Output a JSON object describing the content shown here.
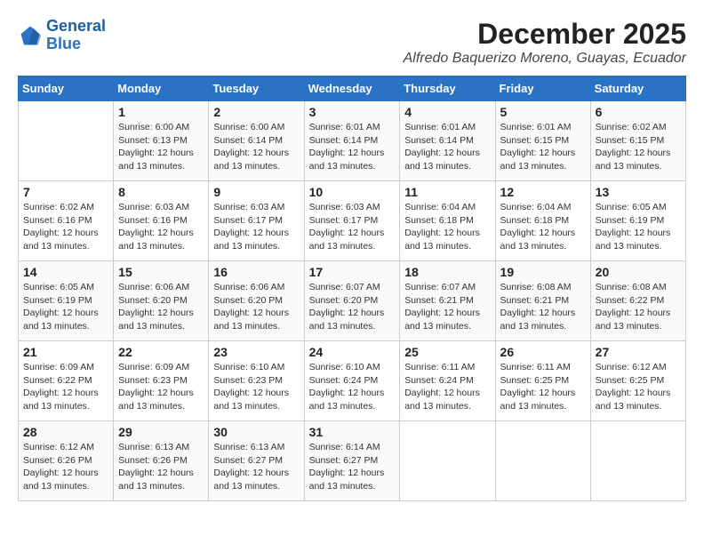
{
  "logo": {
    "line1": "General",
    "line2": "Blue"
  },
  "title": "December 2025",
  "location": "Alfredo Baquerizo Moreno, Guayas, Ecuador",
  "weekdays": [
    "Sunday",
    "Monday",
    "Tuesday",
    "Wednesday",
    "Thursday",
    "Friday",
    "Saturday"
  ],
  "weeks": [
    [
      {
        "day": "",
        "info": ""
      },
      {
        "day": "1",
        "info": "Sunrise: 6:00 AM\nSunset: 6:13 PM\nDaylight: 12 hours\nand 13 minutes."
      },
      {
        "day": "2",
        "info": "Sunrise: 6:00 AM\nSunset: 6:14 PM\nDaylight: 12 hours\nand 13 minutes."
      },
      {
        "day": "3",
        "info": "Sunrise: 6:01 AM\nSunset: 6:14 PM\nDaylight: 12 hours\nand 13 minutes."
      },
      {
        "day": "4",
        "info": "Sunrise: 6:01 AM\nSunset: 6:14 PM\nDaylight: 12 hours\nand 13 minutes."
      },
      {
        "day": "5",
        "info": "Sunrise: 6:01 AM\nSunset: 6:15 PM\nDaylight: 12 hours\nand 13 minutes."
      },
      {
        "day": "6",
        "info": "Sunrise: 6:02 AM\nSunset: 6:15 PM\nDaylight: 12 hours\nand 13 minutes."
      }
    ],
    [
      {
        "day": "7",
        "info": "Sunrise: 6:02 AM\nSunset: 6:16 PM\nDaylight: 12 hours\nand 13 minutes."
      },
      {
        "day": "8",
        "info": "Sunrise: 6:03 AM\nSunset: 6:16 PM\nDaylight: 12 hours\nand 13 minutes."
      },
      {
        "day": "9",
        "info": "Sunrise: 6:03 AM\nSunset: 6:17 PM\nDaylight: 12 hours\nand 13 minutes."
      },
      {
        "day": "10",
        "info": "Sunrise: 6:03 AM\nSunset: 6:17 PM\nDaylight: 12 hours\nand 13 minutes."
      },
      {
        "day": "11",
        "info": "Sunrise: 6:04 AM\nSunset: 6:18 PM\nDaylight: 12 hours\nand 13 minutes."
      },
      {
        "day": "12",
        "info": "Sunrise: 6:04 AM\nSunset: 6:18 PM\nDaylight: 12 hours\nand 13 minutes."
      },
      {
        "day": "13",
        "info": "Sunrise: 6:05 AM\nSunset: 6:19 PM\nDaylight: 12 hours\nand 13 minutes."
      }
    ],
    [
      {
        "day": "14",
        "info": "Sunrise: 6:05 AM\nSunset: 6:19 PM\nDaylight: 12 hours\nand 13 minutes."
      },
      {
        "day": "15",
        "info": "Sunrise: 6:06 AM\nSunset: 6:20 PM\nDaylight: 12 hours\nand 13 minutes."
      },
      {
        "day": "16",
        "info": "Sunrise: 6:06 AM\nSunset: 6:20 PM\nDaylight: 12 hours\nand 13 minutes."
      },
      {
        "day": "17",
        "info": "Sunrise: 6:07 AM\nSunset: 6:20 PM\nDaylight: 12 hours\nand 13 minutes."
      },
      {
        "day": "18",
        "info": "Sunrise: 6:07 AM\nSunset: 6:21 PM\nDaylight: 12 hours\nand 13 minutes."
      },
      {
        "day": "19",
        "info": "Sunrise: 6:08 AM\nSunset: 6:21 PM\nDaylight: 12 hours\nand 13 minutes."
      },
      {
        "day": "20",
        "info": "Sunrise: 6:08 AM\nSunset: 6:22 PM\nDaylight: 12 hours\nand 13 minutes."
      }
    ],
    [
      {
        "day": "21",
        "info": "Sunrise: 6:09 AM\nSunset: 6:22 PM\nDaylight: 12 hours\nand 13 minutes."
      },
      {
        "day": "22",
        "info": "Sunrise: 6:09 AM\nSunset: 6:23 PM\nDaylight: 12 hours\nand 13 minutes."
      },
      {
        "day": "23",
        "info": "Sunrise: 6:10 AM\nSunset: 6:23 PM\nDaylight: 12 hours\nand 13 minutes."
      },
      {
        "day": "24",
        "info": "Sunrise: 6:10 AM\nSunset: 6:24 PM\nDaylight: 12 hours\nand 13 minutes."
      },
      {
        "day": "25",
        "info": "Sunrise: 6:11 AM\nSunset: 6:24 PM\nDaylight: 12 hours\nand 13 minutes."
      },
      {
        "day": "26",
        "info": "Sunrise: 6:11 AM\nSunset: 6:25 PM\nDaylight: 12 hours\nand 13 minutes."
      },
      {
        "day": "27",
        "info": "Sunrise: 6:12 AM\nSunset: 6:25 PM\nDaylight: 12 hours\nand 13 minutes."
      }
    ],
    [
      {
        "day": "28",
        "info": "Sunrise: 6:12 AM\nSunset: 6:26 PM\nDaylight: 12 hours\nand 13 minutes."
      },
      {
        "day": "29",
        "info": "Sunrise: 6:13 AM\nSunset: 6:26 PM\nDaylight: 12 hours\nand 13 minutes."
      },
      {
        "day": "30",
        "info": "Sunrise: 6:13 AM\nSunset: 6:27 PM\nDaylight: 12 hours\nand 13 minutes."
      },
      {
        "day": "31",
        "info": "Sunrise: 6:14 AM\nSunset: 6:27 PM\nDaylight: 12 hours\nand 13 minutes."
      },
      {
        "day": "",
        "info": ""
      },
      {
        "day": "",
        "info": ""
      },
      {
        "day": "",
        "info": ""
      }
    ]
  ]
}
